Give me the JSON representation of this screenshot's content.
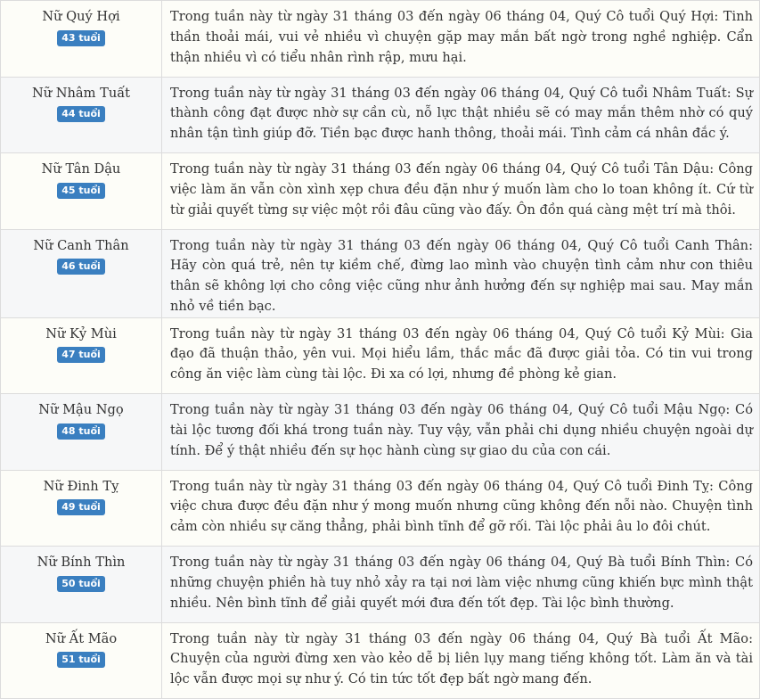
{
  "rows": [
    {
      "name": "Nữ Quý Hợi",
      "age": "43 tuổi",
      "text": "Trong tuần này từ ngày 31 tháng 03 đến ngày 06 tháng 04, Quý Cô tuổi Quý Hợi: Tinh thần thoải mái, vui vẻ nhiều vì chuyện gặp may mắn bất ngờ trong nghề nghiệp. Cẩn thận nhiều vì có tiểu nhân rình rập, mưu hại."
    },
    {
      "name": "Nữ Nhâm Tuất",
      "age": "44 tuổi",
      "text": "Trong tuần này từ ngày 31 tháng 03 đến ngày 06 tháng 04, Quý Cô tuổi Nhâm Tuất: Sự thành công đạt được nhờ sự cần cù, nỗ lực thật nhiều sẽ có may mắn thêm nhờ có quý nhân tận tình giúp đỡ. Tiền bạc được hanh thông, thoải mái. Tình cảm cá nhân đắc ý."
    },
    {
      "name": "Nữ Tân Dậu",
      "age": "45 tuổi",
      "text": "Trong tuần này từ ngày 31 tháng 03 đến ngày 06 tháng 04, Quý Cô tuổi Tân Dậu: Công việc làm ăn vẫn còn xình xẹp chưa đều đặn như ý muốn làm cho lo toan không ít. Cứ từ từ giải quyết từng sự việc một rồi đâu cũng vào đấy. Ôn đồn quá càng mệt trí mà thôi."
    },
    {
      "name": "Nữ Canh Thân",
      "age": "46 tuổi",
      "text": "Trong tuần này từ ngày 31 tháng 03 đến ngày 06 tháng 04, Quý Cô tuổi Canh Thân: Hãy còn quá trẻ, nên tự kiềm chế, đừng lao mình vào chuyện tình cảm như con thiêu thân sẽ không lợi cho công việc cũng như ảnh hưởng đến sự nghiệp mai sau. May mắn nhỏ về tiền bạc."
    },
    {
      "name": "Nữ Kỷ Mùi",
      "age": "47 tuổi",
      "text": "Trong tuần này từ ngày 31 tháng 03 đến ngày 06 tháng 04, Quý Cô tuổi Kỷ Mùi: Gia đạo đã thuận thảo, yên vui. Mọi hiểu lầm, thắc mắc đã được giải tỏa. Có tin vui trong công ăn việc làm cùng tài lộc. Đi xa có lợi, nhưng đề phòng kẻ gian."
    },
    {
      "name": "Nữ Mậu Ngọ",
      "age": "48 tuổi",
      "text": "Trong tuần này từ ngày 31 tháng 03 đến ngày 06 tháng 04, Quý Cô tuổi Mậu Ngọ: Có tài lộc tương đối khá trong tuần này. Tuy vậy, vẫn phải chi dụng nhiều chuyện ngoài dự tính. Để ý thật nhiều đến sự học hành cùng sự giao du của con cái."
    },
    {
      "name": "Nữ Đinh Tỵ",
      "age": "49 tuổi",
      "text": "Trong tuần này từ ngày 31 tháng 03 đến ngày 06 tháng 04, Quý Cô tuổi Đinh Tỵ: Công việc chưa được đều đặn như ý mong muốn nhưng cũng không đến nỗi nào. Chuyện tình cảm còn nhiều sự căng thẳng, phải bình tĩnh để gỡ rối. Tài lộc phải âu lo đôi chút."
    },
    {
      "name": "Nữ Bính Thìn",
      "age": "50 tuổi",
      "text": "Trong tuần này từ ngày 31 tháng 03 đến ngày 06 tháng 04, Quý Bà tuổi Bính Thìn: Có những chuyện phiền hà tuy nhỏ xảy ra tại nơi làm việc nhưng cũng khiến bực mình thật nhiều. Nên bình tĩnh để giải quyết mới đưa đến tốt đẹp. Tài lộc bình thường."
    },
    {
      "name": "Nữ Ất Mão",
      "age": "51 tuổi",
      "text": "Trong tuần này từ ngày 31 tháng 03 đến ngày 06 tháng 04, Quý Bà tuổi Ất Mão: Chuyện của người đừng xen vào kẻo dễ bị liên lụy mang tiếng không tốt. Làm ăn và tài lộc vẫn được mọi sự như ý. Có tin tức tốt đẹp bất ngờ mang đến."
    }
  ],
  "colors": {
    "badge": "#3a7fc0",
    "border": "#dcdcdc",
    "row_odd": "#fdfdf8",
    "row_even": "#f6f7f8"
  }
}
